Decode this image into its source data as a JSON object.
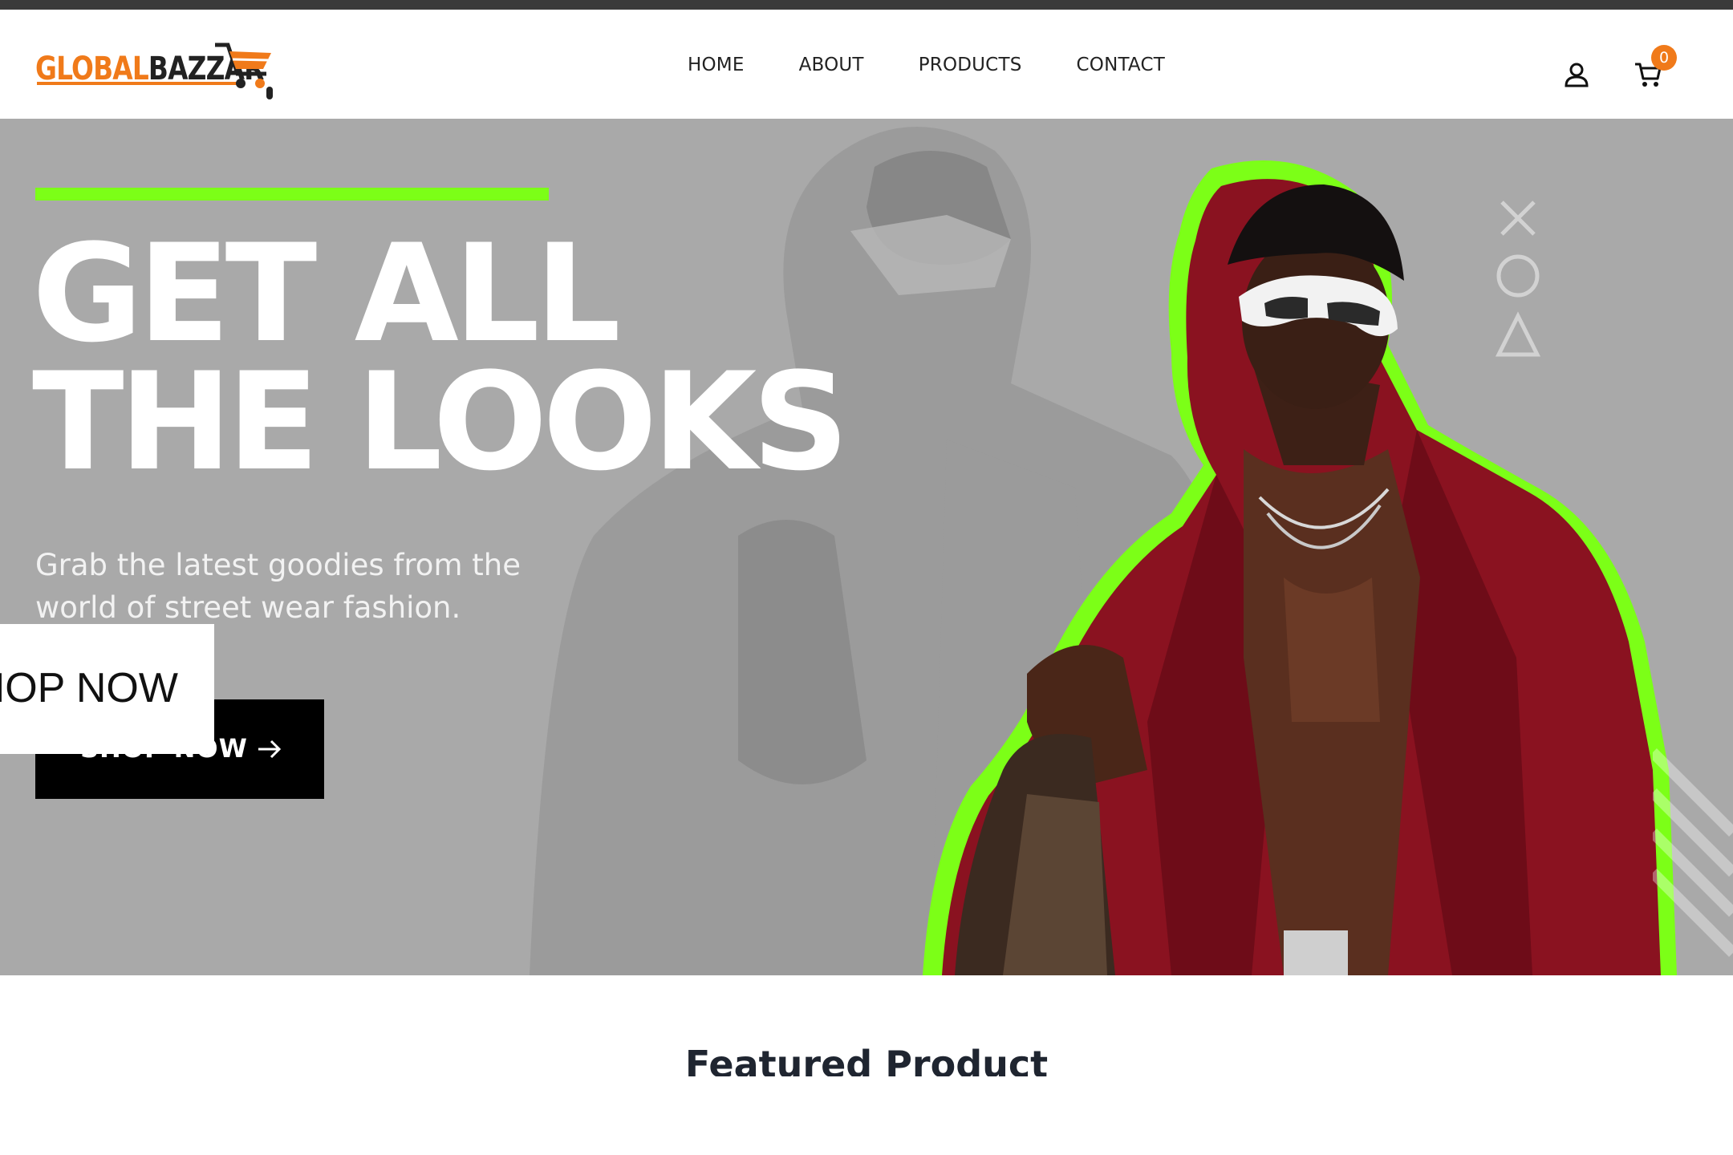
{
  "brand": {
    "name_part1": "GLOBAL",
    "name_part2": "BAZZAR",
    "primary_color": "#f07a1a",
    "dark_color": "#222222"
  },
  "nav": {
    "links": [
      "HOME",
      "ABOUT",
      "PRODUCTS",
      "CONTACT"
    ]
  },
  "header_actions": {
    "cart_count": "0",
    "icons": [
      "user-icon",
      "cart-icon"
    ]
  },
  "hero": {
    "accent_color": "#7cff17",
    "headline_line1": "GET ALL",
    "headline_line2": "THE LOOKS",
    "subtext": "Grab the latest goodies from the world of street wear fashion.",
    "button_label": "SHOP NOW",
    "overlay_label": "SHOP NOW",
    "decorative_shapes": [
      "x-icon",
      "circle-icon",
      "triangle-icon"
    ]
  },
  "featured": {
    "title": "Featured Product"
  }
}
